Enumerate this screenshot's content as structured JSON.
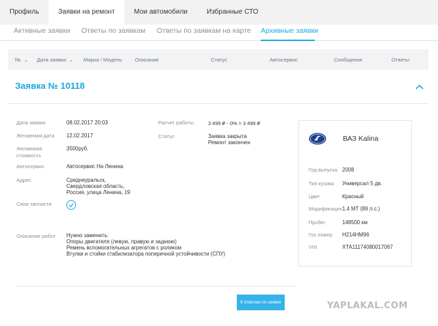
{
  "top_tabs": [
    {
      "label": "Профиль",
      "active": false
    },
    {
      "label": "Заявки на ремонт",
      "active": true
    },
    {
      "label": "Мои автомобили",
      "active": false
    },
    {
      "label": "Избранные СТО",
      "active": false
    }
  ],
  "sub_tabs": [
    {
      "label": "Активные заявки",
      "active": false
    },
    {
      "label": "Ответы по заявкам",
      "active": false
    },
    {
      "label": "Ответы по заявкам на карте",
      "active": false
    },
    {
      "label": "Архивные заявки",
      "active": true
    }
  ],
  "table_header": {
    "number": "№",
    "date": "Дата заявки",
    "model": "Марка / Модель",
    "description": "Описание",
    "status": "Статус",
    "service": "Автосервис",
    "messages": "Сообщения",
    "answers": "Ответы"
  },
  "request": {
    "title": "Заявка № 10118",
    "fields": {
      "date_label": "Дата заявки",
      "date_value": "08.02.2017 20:03",
      "desired_date_label": "Желаемая дата",
      "desired_date_value": "12.02.2017",
      "desired_cost_label_1": "Желаемая",
      "desired_cost_label_2": "стоимость",
      "desired_cost_value": "3500руб.",
      "service_label": "Автосервис",
      "service_value": "Автосервис На Ленина",
      "address_label": "Адрес",
      "address_lines": [
        "Среднеуральск,",
        "Свердловская область,",
        "Россия, улица Ленина, 19"
      ],
      "own_parts_label": "Свои запчасти",
      "calc_label": "Расчет работы",
      "calc_value": "3 499 ₽ - 0% = 3 499 ₽",
      "status_label": "Статус",
      "status_lines": [
        "Заявка закрыта",
        "Ремонт закончен"
      ],
      "work_desc_label": "Описание работ",
      "work_desc_lines": [
        "Нужно заменить:",
        "Опоры двигателя (левую, правую и заднюю)",
        "Ремень вспомогательных агрегатов с роликом",
        "Втулки и стойки стабилизатора поперечной устойчивости (СПУ)"
      ]
    },
    "car": {
      "name": "ВАЗ Kalina",
      "year_label": "Год выпуска",
      "year_value": "2008",
      "body_label": "Тип кузова",
      "body_value": "Универсал 5 дв.",
      "color_label": "Цвет",
      "color_value": "Красный",
      "mod_label": "Модификация",
      "mod_value": "1.4 MT (89 л.с.)",
      "mileage_label": "Пробег",
      "mileage_value": "148500 км",
      "plate_label": "Гос.номер",
      "plate_value": "Н214НМ96",
      "vin_label": "VIN",
      "vin_value": "XTA11174080017067"
    },
    "answers_button": "К ответам по заявке"
  },
  "watermark": "YAPLAKAL.COM",
  "colors": {
    "accent": "#1ba7e0",
    "button": "#35b3ea",
    "header_bg": "#f2f3f4"
  }
}
